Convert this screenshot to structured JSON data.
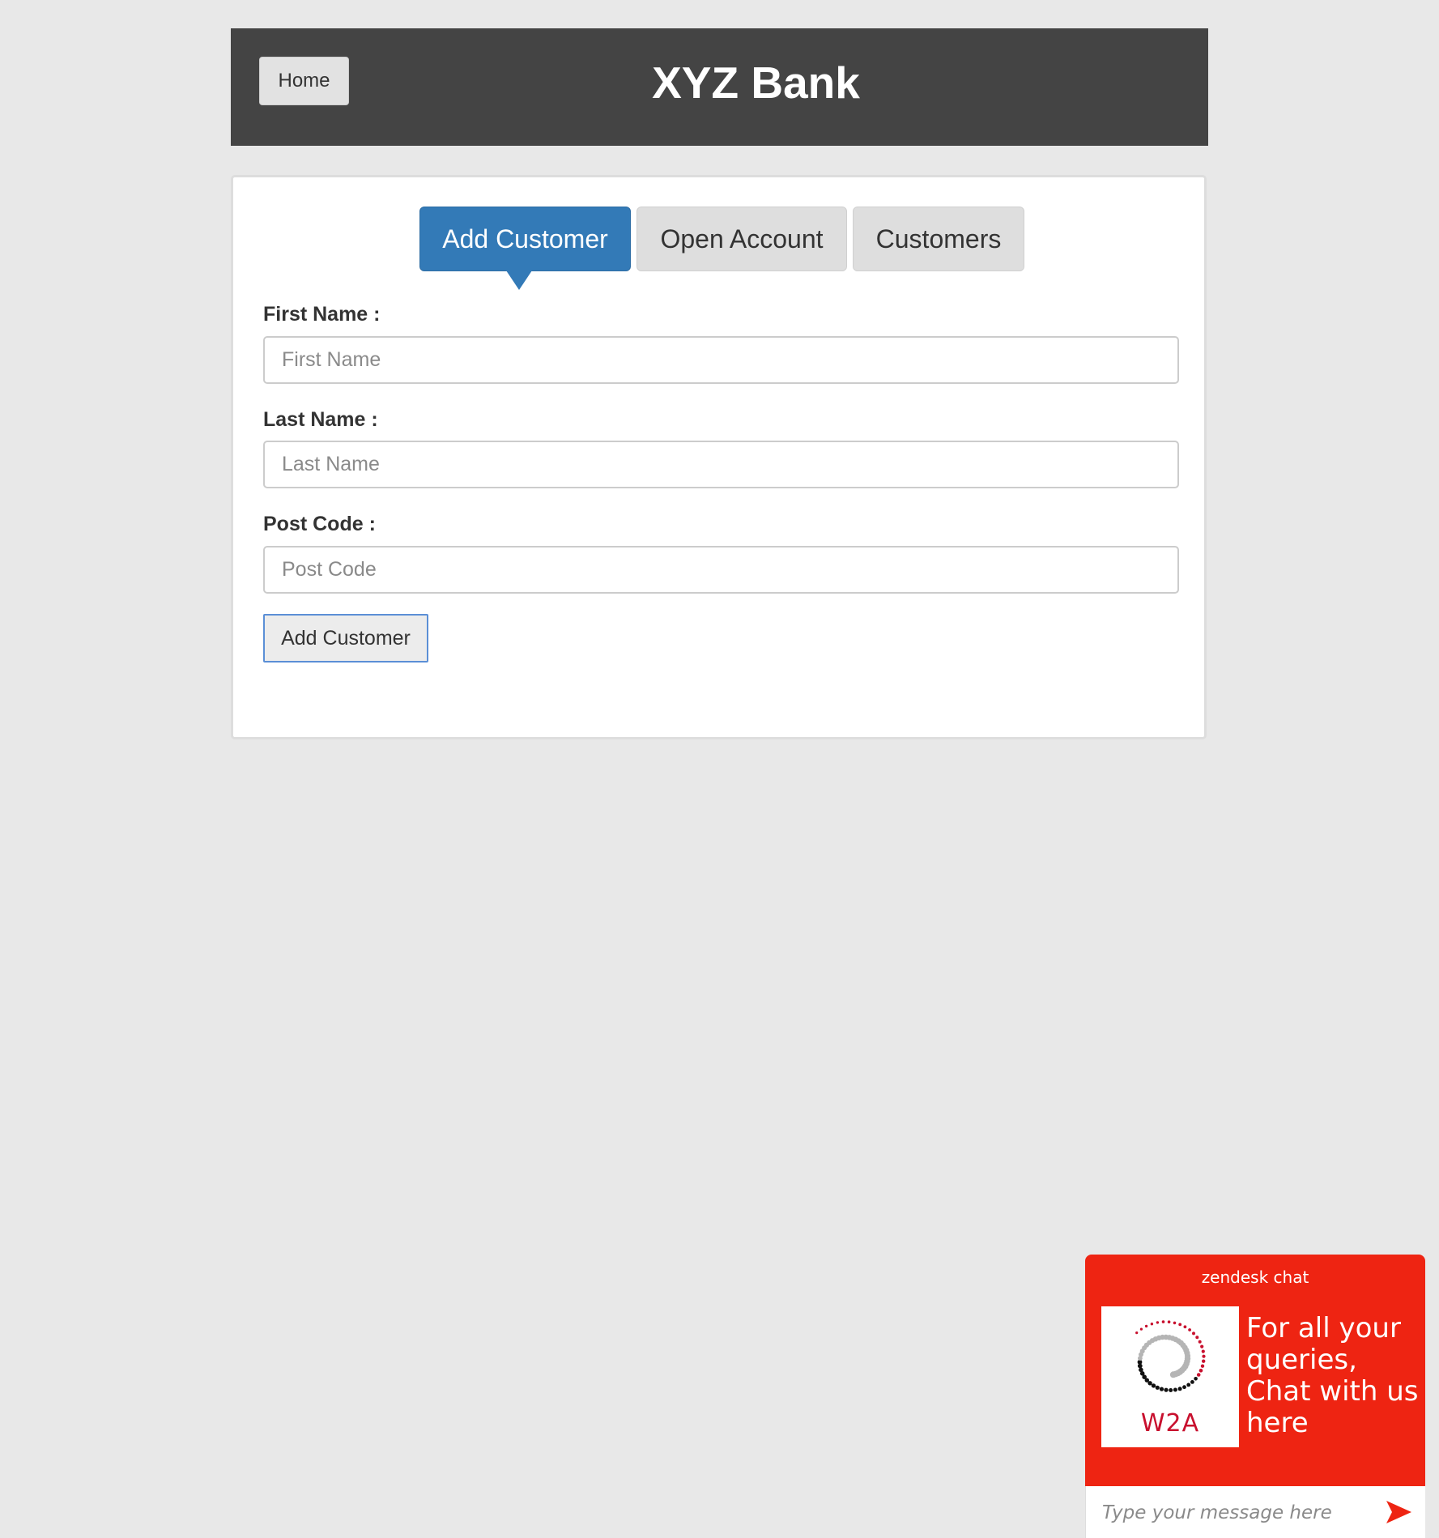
{
  "header": {
    "home_label": "Home",
    "title": "XYZ Bank"
  },
  "tabs": [
    {
      "label": "Add Customer",
      "active": true
    },
    {
      "label": "Open Account",
      "active": false
    },
    {
      "label": "Customers",
      "active": false
    }
  ],
  "form": {
    "first_name_label": "First Name :",
    "first_name_placeholder": "First Name",
    "last_name_label": "Last Name :",
    "last_name_placeholder": "Last Name",
    "post_code_label": "Post Code :",
    "post_code_placeholder": "Post Code",
    "submit_label": "Add Customer"
  },
  "chat": {
    "brand": "zendesk chat",
    "logo_text": "W2A",
    "message": "For all your queries, Chat with us here",
    "input_placeholder": "Type your message here"
  },
  "colors": {
    "header_bg": "#444444",
    "accent": "#337ab7",
    "chat_bg": "#ee2412"
  },
  "icons": {
    "send": "send-arrow-icon",
    "logo": "w2a-logo-icon"
  }
}
